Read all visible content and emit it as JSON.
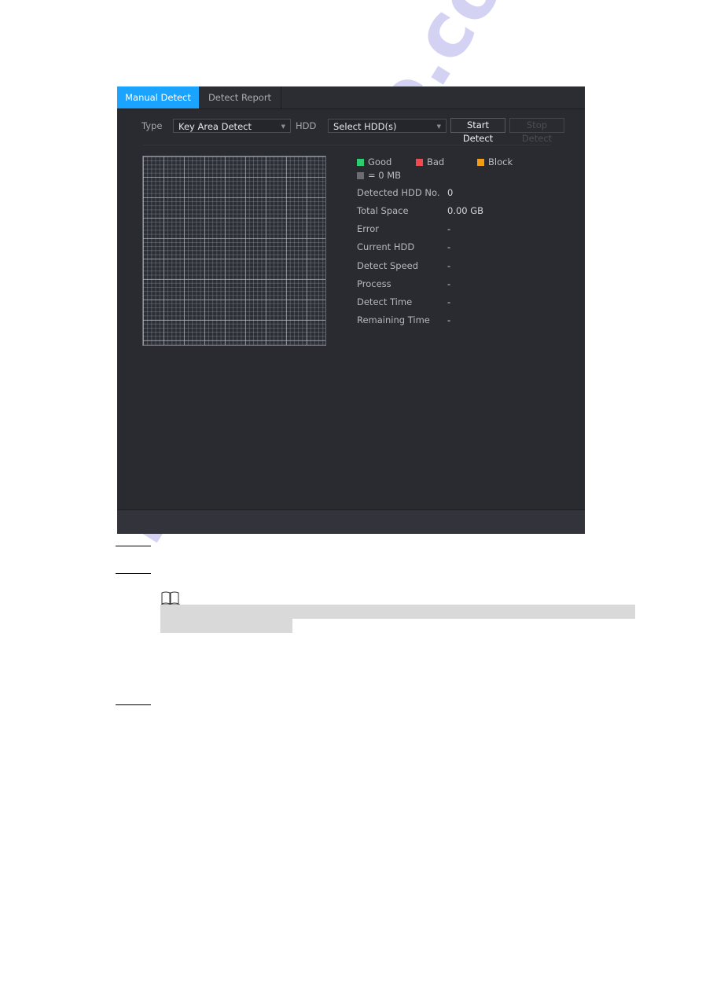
{
  "tabs": [
    {
      "label": "Manual Detect",
      "active": true
    },
    {
      "label": "Detect Report",
      "active": false
    }
  ],
  "controls": {
    "type_label": "Type",
    "type_value": "Key Area Detect",
    "hdd_label": "HDD",
    "hdd_value": "Select HDD(s)",
    "start_label": "Start Detect",
    "stop_label": "Stop Detect",
    "arrow_glyph": "▼"
  },
  "legend": [
    {
      "label": "Good",
      "color": "#2ecc71"
    },
    {
      "label": "Bad",
      "color": "#f0494f"
    },
    {
      "label": "Block",
      "color": "#f39c12"
    },
    {
      "label": "= 0 MB",
      "color": "#6b6d73"
    }
  ],
  "info": [
    {
      "label": "Detected HDD No.",
      "value": "0"
    },
    {
      "label": "Total Space",
      "value": "0.00 GB"
    },
    {
      "label": "Error",
      "value": "-"
    },
    {
      "label": "Current HDD",
      "value": "-"
    },
    {
      "label": "Detect Speed",
      "value": "-"
    },
    {
      "label": "Process",
      "value": "-"
    },
    {
      "label": "Detect Time",
      "value": "-"
    },
    {
      "label": "Remaining Time",
      "value": "-"
    }
  ],
  "watermark": "manualshive.com"
}
